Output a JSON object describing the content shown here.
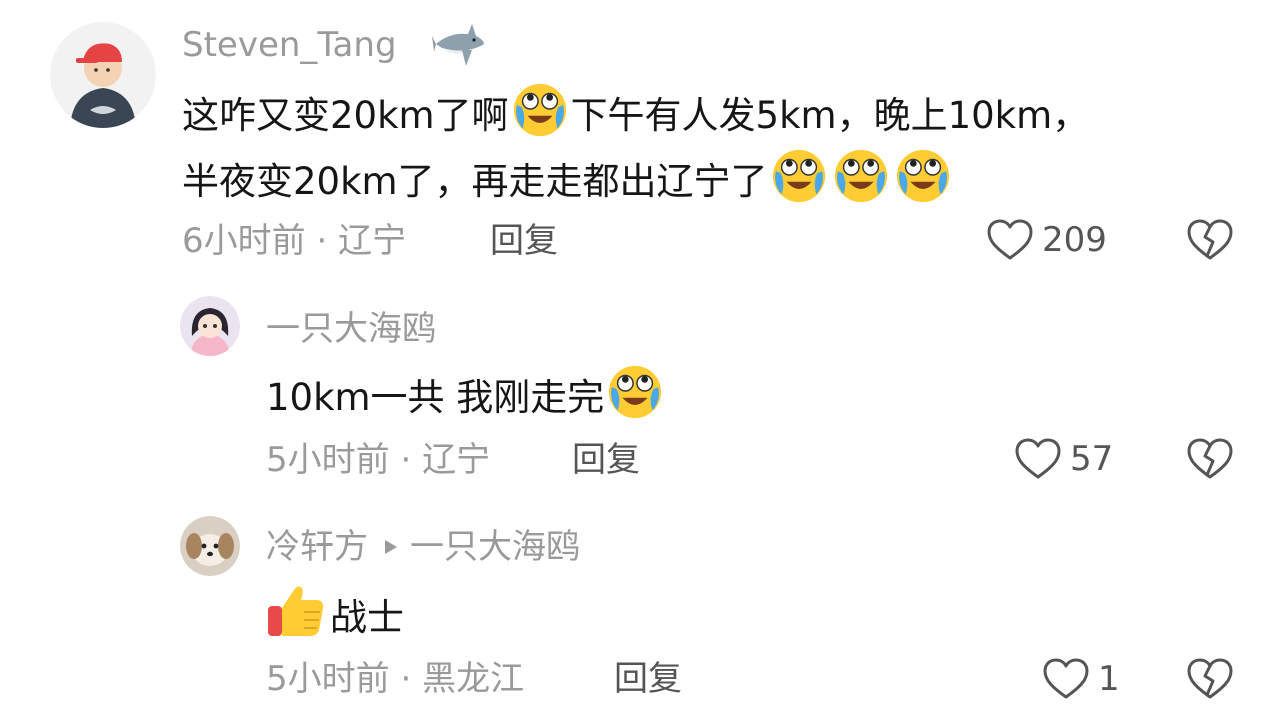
{
  "comments": [
    {
      "author": "Steven_Tang",
      "badge_icon": "shark-icon",
      "line1_a": "这咋又变20km了啊",
      "line1_b": "下午有人发5km，晚上10km，",
      "line2": "半夜变20km了，再走走都出辽宁了",
      "emoji": "crying-laughing-emoji",
      "time": "6小时前",
      "location": "辽宁",
      "reply_label": "回复",
      "likes": "209"
    },
    {
      "author": "一只大海鸥",
      "text": "10km一共 我刚走完",
      "emoji": "crying-laughing-emoji",
      "time": "5小时前",
      "location": "辽宁",
      "reply_label": "回复",
      "likes": "57"
    },
    {
      "author": "冷轩方",
      "reply_to": "一只大海鸥",
      "emoji": "thumbs-up-emoji",
      "text": "战士",
      "time": "5小时前",
      "location": "黑龙江",
      "reply_label": "回复",
      "likes": "1"
    }
  ],
  "meta_separator": "·",
  "icons": {
    "like": "heart-icon",
    "dislike": "broken-heart-icon",
    "reply_arrow": "triangle-right-icon"
  },
  "colors": {
    "muted_text": "#9a9a9a",
    "body_text": "#161616",
    "emoji_yellow": "#FFCC33",
    "tear_blue": "#4aa8e8"
  }
}
